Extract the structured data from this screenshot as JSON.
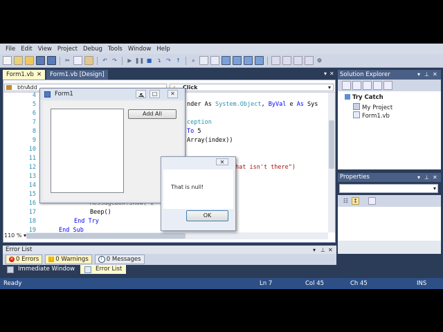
{
  "menu": [
    "File",
    "Edit",
    "View",
    "Project",
    "Debug",
    "Tools",
    "Window",
    "Help"
  ],
  "doc_tabs": [
    {
      "label": "Form1.vb",
      "active": true
    },
    {
      "label": "Form1.vb [Design]",
      "active": false
    }
  ],
  "editor": {
    "nav_left": "btnAdd",
    "nav_right": "Click",
    "zoom": "110 %",
    "line_numbers": [
      "4",
      "5",
      "6",
      "7",
      "8",
      "9",
      "10",
      "11",
      "12",
      "13",
      "14",
      "15",
      "16",
      "17",
      "18",
      "19"
    ],
    "code": {
      "l5a": "nder As ",
      "l5b": "System.Object",
      "l5c": ", ",
      "l5d": "ByVal",
      "l5e": " e ",
      "l5f": "As",
      "l5g": " Sys",
      "l7": "ception",
      "l8a": "To",
      "l8b": " 5",
      "l9": "Array(index))",
      "l12": "hat isn't there\")",
      "l16a": "MessageBox.Show( I",
      "l17": "Beep()",
      "l18": "End Try",
      "l19": "End Sub"
    }
  },
  "form1": {
    "title": "Form1",
    "add_all_button": "Add All"
  },
  "msgbox": {
    "text": "That is null!",
    "ok": "OK"
  },
  "solution_explorer": {
    "title": "Solution Explorer",
    "items": [
      "Try Catch",
      "My Project",
      "Form1.vb"
    ]
  },
  "properties": {
    "title": "Properties"
  },
  "error_list": {
    "title": "Error List",
    "errors": "0 Errors",
    "warnings": "0 Warnings",
    "messages": "0 Messages"
  },
  "bottom_tabs": [
    "Immediate Window",
    "Error List"
  ],
  "status": {
    "ready": "Ready",
    "ln": "Ln 7",
    "col": "Col 45",
    "ch": "Ch 45",
    "ins": "INS"
  },
  "colors": {
    "ide_background": "#2b3c59",
    "status_bar": "#2d4f86",
    "active_tab": "#fffacd"
  }
}
